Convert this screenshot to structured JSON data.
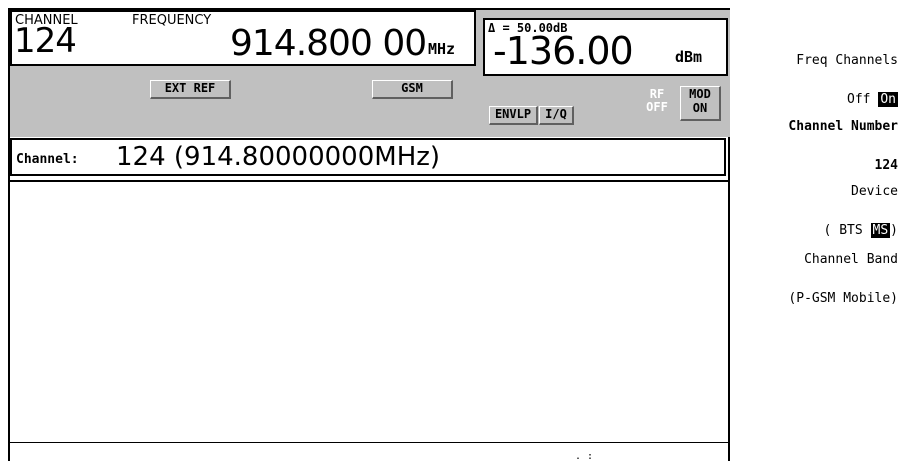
{
  "display": {
    "channel_label": "CHANNEL",
    "channel_value": "124",
    "frequency_label": "FREQUENCY",
    "frequency_value": "914.800 00",
    "frequency_unit": "MHz",
    "amp_delta": "Δ = 50.00dB",
    "amp_value": "-136.00",
    "amp_unit": "dBm",
    "annunciators": {
      "ext_ref": "EXT REF",
      "gsm": "GSM",
      "envlp": "ENVLP",
      "iq": "I/Q",
      "rf_off_1": "RF",
      "rf_off_2": "OFF",
      "mod_on_1": "MOD",
      "mod_on_2": "ON"
    },
    "channel_line_label": "Channel:",
    "channel_line_value": "124 (914.80000000MHz)",
    "bottom_text": ". :"
  },
  "softkeys": {
    "freq_channels_line1": "Freq Channels",
    "freq_channels_off": "Off",
    "freq_channels_on": "On",
    "channel_number_line1": "Channel Number",
    "channel_number_value": "124",
    "device_line1": "Device",
    "device_open": "( BTS",
    "device_ms": "MS",
    "device_close": ")",
    "channel_band_line1": "Channel Band",
    "channel_band_line2": "(P-GSM Mobile)"
  },
  "colors": {
    "status_bg": "#c0c0c0",
    "rf_off_text": "#ffffff"
  }
}
